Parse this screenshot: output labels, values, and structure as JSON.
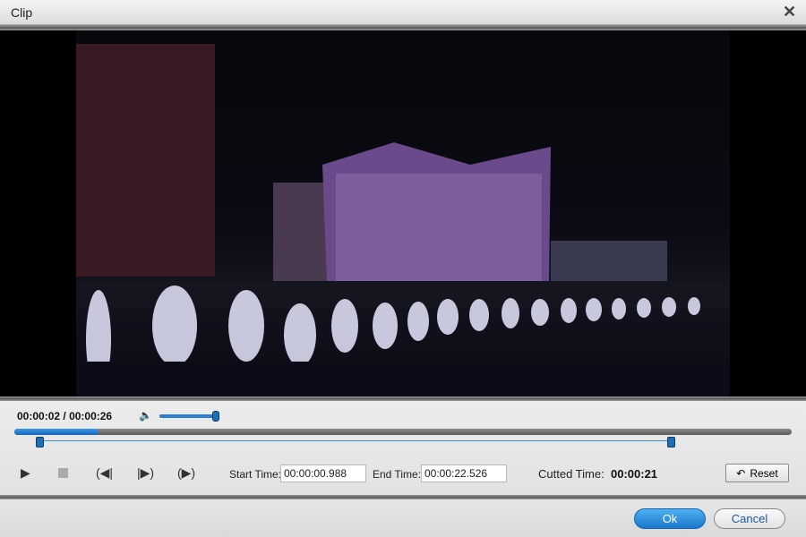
{
  "window": {
    "title": "Clip",
    "close_icon": "close-icon"
  },
  "player": {
    "current_time": "00:00:02",
    "total_time": "00:00:26",
    "time_separator": " / ",
    "volume_fraction": 1.0,
    "progress_fraction": 0.108,
    "range_start_fraction": 0.032,
    "range_end_fraction": 0.845
  },
  "trim": {
    "start_label": "Start Time:",
    "start_value": "00:00:00.988",
    "end_label": "End Time:",
    "end_value": "00:00:22.526",
    "cutted_label": "Cutted Time:",
    "cutted_value": "00:00:21",
    "reset_label": "Reset"
  },
  "footer": {
    "ok_label": "Ok",
    "cancel_label": "Cancel"
  },
  "colors": {
    "accent": "#1a78cc",
    "progress": "#2a80d0"
  }
}
